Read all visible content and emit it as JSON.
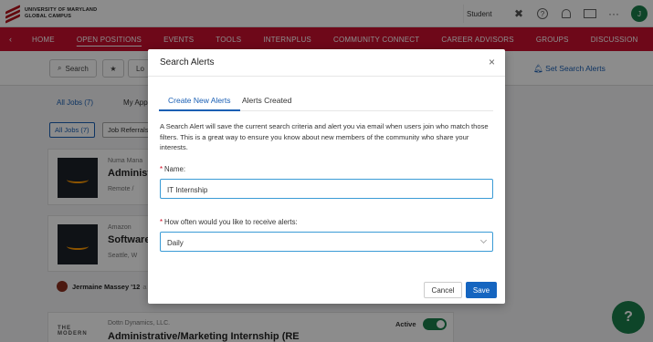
{
  "brand": {
    "line1": "UNIVERSITY OF MARYLAND",
    "line2": "GLOBAL CAMPUS"
  },
  "topbar": {
    "role": "Student",
    "help_glyph": "?",
    "more": "···",
    "avatar_initial": "J"
  },
  "nav": {
    "items": [
      "HOME",
      "OPEN POSITIONS",
      "EVENTS",
      "TOOLS",
      "INTERNPLUS",
      "COMMUNITY CONNECT",
      "CAREER ADVISORS",
      "GROUPS",
      "DISCUSSION"
    ],
    "active": "OPEN POSITIONS"
  },
  "background": {
    "search_label": "Search",
    "loc_label": "Lo",
    "set_alerts_label": "Set Search Alerts",
    "tab_all_jobs": "All Jobs (7)",
    "tab_my_apps": "My App",
    "chip_all_jobs": "All Jobs (7)",
    "chip_referrals": "Job Referrals",
    "card1": {
      "company": "Numa Mana",
      "title": "Administr",
      "location": "Remote / "
    },
    "card2": {
      "company": "Amazon",
      "title": "Software",
      "location": "Seattle, W"
    },
    "poster": "Jermaine Massey '12",
    "poster_suffix": "a",
    "card3": {
      "company": "Dottn Dynamics, LLC.",
      "title": "Administrative/Marketing Internship (RE",
      "logo_text": "THE MODERN",
      "status": "Active"
    },
    "help_glyph": "?"
  },
  "modal": {
    "title": "Search Alerts",
    "close": "×",
    "tabs": [
      "Create New Alerts",
      "Alerts Created"
    ],
    "description": "A Search Alert will save the current search criteria and alert you via email when users join who match those filters. This is a great way to ensure you know about new members of the community who share your interests.",
    "name_label": "Name:",
    "name_value": "IT Internship",
    "freq_label": "How often would you like to receive alerts:",
    "freq_value": "Daily",
    "required_mark": "*",
    "cancel_label": "Cancel",
    "save_label": "Save"
  }
}
